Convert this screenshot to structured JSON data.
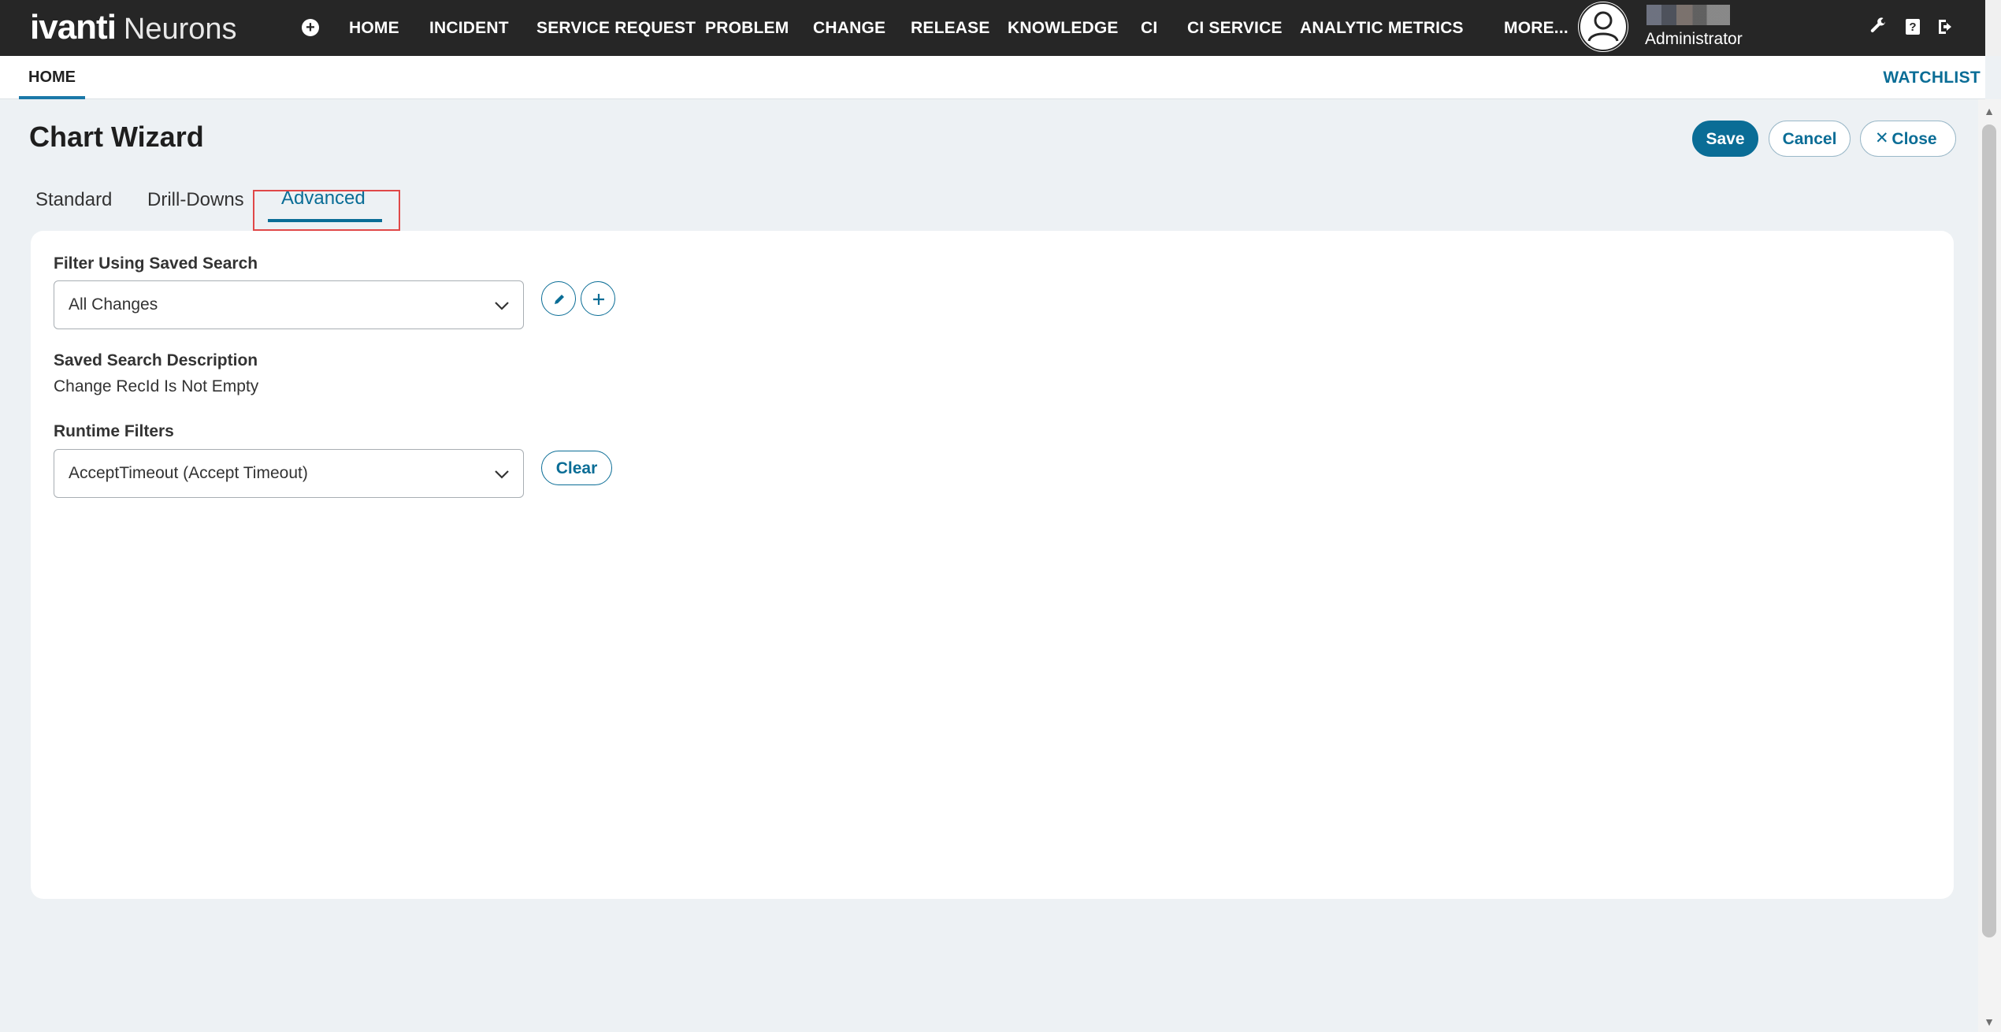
{
  "app": {
    "brand_primary": "ivanti",
    "brand_secondary": "Neurons",
    "add_icon": "plus-circle-icon"
  },
  "nav": {
    "items": [
      "HOME",
      "INCIDENT",
      "SERVICE REQUEST",
      "PROBLEM",
      "CHANGE",
      "RELEASE",
      "KNOWLEDGE",
      "CI",
      "CI SERVICE",
      "ANALYTIC METRICS",
      "MORE..."
    ],
    "user_role": "Administrator",
    "icons": [
      "wrench-icon",
      "help-icon",
      "logout-icon"
    ]
  },
  "workspace": {
    "tab": "HOME",
    "watchlist": "WATCHLIST"
  },
  "page": {
    "title": "Chart Wizard",
    "save": "Save",
    "cancel": "Cancel",
    "close": "Close"
  },
  "wizard_tabs": {
    "items": [
      "Standard",
      "Drill-Downs",
      "Advanced"
    ],
    "active": "Advanced"
  },
  "form": {
    "filter_label": "Filter Using Saved Search",
    "filter_value": "All Changes",
    "desc_label": "Saved Search Description",
    "desc_value": "Change RecId Is Not Empty",
    "runtime_label": "Runtime Filters",
    "runtime_value": "AcceptTimeout (Accept Timeout)",
    "clear": "Clear"
  },
  "colors": {
    "accent": "#0a6d96",
    "nav_bg": "#262626",
    "page_bg": "#edf1f4",
    "highlight": "#e04848"
  }
}
